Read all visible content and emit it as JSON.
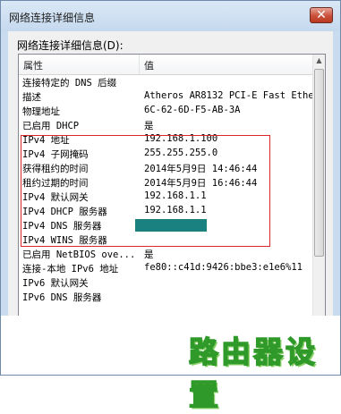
{
  "window": {
    "title": "网络连接详细信息",
    "close_glyph": "✕"
  },
  "section_label": "网络连接详细信息(D):",
  "table": {
    "columns": [
      "属性",
      "值"
    ],
    "rows": [
      {
        "property": "连接特定的 DNS 后缀",
        "value": ""
      },
      {
        "property": "描述",
        "value": "Atheros AR8132 PCI-E Fast Ethe"
      },
      {
        "property": "物理地址",
        "value": "6C-62-6D-F5-AB-3A"
      },
      {
        "property": "已启用 DHCP",
        "value": "是"
      },
      {
        "property": "IPv4 地址",
        "value": "192.168.1.100"
      },
      {
        "property": "IPv4 子网掩码",
        "value": "255.255.255.0"
      },
      {
        "property": "获得租约的时间",
        "value": "2014年5月9日 14:46:44"
      },
      {
        "property": "租约过期的时间",
        "value": "2014年5月9日 16:46:44"
      },
      {
        "property": "IPv4 默认网关",
        "value": "192.168.1.1"
      },
      {
        "property": "IPv4 DHCP 服务器",
        "value": "192.168.1.1"
      },
      {
        "property": "IPv4 DNS 服务器",
        "value": ""
      },
      {
        "property": "IPv4 WINS 服务器",
        "value": ""
      },
      {
        "property": "已启用 NetBIOS ove...",
        "value": "是"
      },
      {
        "property": "连接-本地 IPv6 地址",
        "value": "fe80::c41d:9426:bbe3:e1e6%11"
      },
      {
        "property": "IPv6 默认网关",
        "value": ""
      },
      {
        "property": "IPv6 DNS 服务器",
        "value": ""
      }
    ]
  },
  "scroll": {
    "up": "▲",
    "down": "▼",
    "left": "◀",
    "right": "▶"
  },
  "colors": {
    "highlight_box": "#d9262c",
    "dns_redacted": "#1b8080",
    "watermark": "#2f9a2a"
  },
  "watermark": "路由器设置"
}
